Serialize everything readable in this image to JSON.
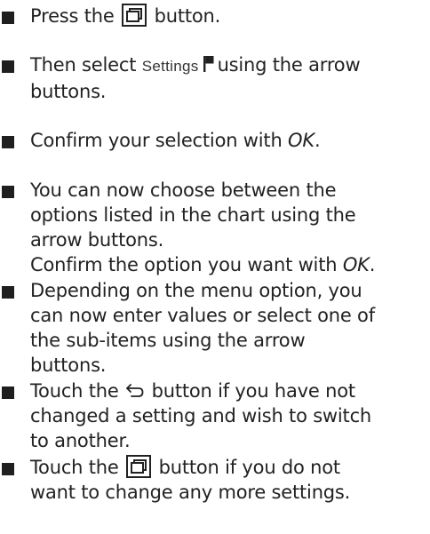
{
  "steps": [
    {
      "text_before": "Press the",
      "icon": "menu-window-icon",
      "text_after": "button."
    },
    {
      "line1_before": "Then select",
      "screen_label": "Settings",
      "icon": "flag-icon",
      "line1_after": "using the arrow",
      "line2": "buttons."
    },
    {
      "text": "Confirm your selection with",
      "emphasis": "OK",
      "end": "."
    },
    {
      "line1": "You can now choose between the",
      "line2": "options listed in the chart using the",
      "line3": "arrow buttons.",
      "line4_before": "Confirm the option you want with",
      "line4_emphasis": "OK",
      "line4_end": "."
    },
    {
      "line1": "Depending on the menu option, you",
      "line2": "can now enter values or select one of",
      "line3": "the sub-items using the arrow",
      "line4": "buttons."
    },
    {
      "line1_before": "Touch the",
      "icon": "back-arrow-icon",
      "line1_after": "button if you have not",
      "line2": "changed a setting and wish to switch",
      "line3": "to another."
    },
    {
      "line1_before": "Touch the",
      "icon": "menu-window-icon",
      "line1_after": "button if you do not",
      "line2": "want to change any more settings."
    }
  ]
}
